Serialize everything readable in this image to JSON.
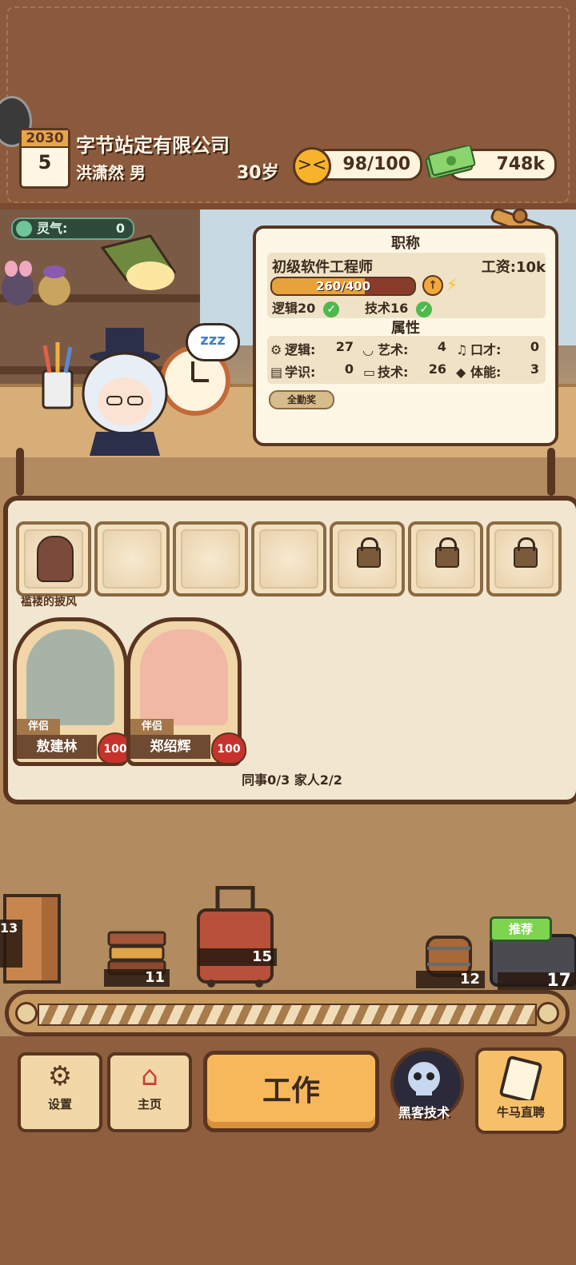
{
  "header": {
    "calendar_year": "2030",
    "calendar_day": "5",
    "company": "字节站定有限公司",
    "person": "洪潇然 男",
    "age": "30岁",
    "mood": "98/100",
    "money": "748k"
  },
  "scene": {
    "aura_label": "灵气:",
    "aura_value": "0",
    "sleep_text": "zzz"
  },
  "card": {
    "title_heading": "职称",
    "job_title": "初级软件工程师",
    "salary": "工资:10k",
    "progress_text": "260/400",
    "progress_fraction": 0.65,
    "req_logic": "逻辑20",
    "req_tech": "技术16",
    "attr_heading": "属性",
    "attributes": [
      {
        "label": "逻辑:",
        "value": "27",
        "icon": "gear-icon"
      },
      {
        "label": "艺术:",
        "value": "4",
        "icon": "lips-icon"
      },
      {
        "label": "口才:",
        "value": "0",
        "icon": "music-note-icon"
      },
      {
        "label": "学识:",
        "value": "0",
        "icon": "book-icon"
      },
      {
        "label": "技术:",
        "value": "26",
        "icon": "monitor-icon"
      },
      {
        "label": "体能:",
        "value": "3",
        "icon": "shield-icon"
      }
    ],
    "badge": "全勤奖"
  },
  "inventory": {
    "first_item_label": "褴褛的披风"
  },
  "mates": [
    {
      "tag": "伴侣",
      "name": "敖建林",
      "affection": "100"
    },
    {
      "tag": "伴侣",
      "name": "郑绍辉",
      "affection": "100"
    }
  ],
  "counts": "同事0/3 家人2/2",
  "conveyor": {
    "items": [
      {
        "name": "door",
        "price": "13"
      },
      {
        "name": "books",
        "price": "11"
      },
      {
        "name": "suitcase",
        "price": "15"
      },
      {
        "name": "barrel",
        "price": "12"
      },
      {
        "name": "chest",
        "price": "17"
      }
    ],
    "recommend": "推荐"
  },
  "nav": {
    "settings": "设置",
    "home": "主页",
    "work": "工作",
    "hack": "黑客技术",
    "hire": "牛马直聘"
  }
}
